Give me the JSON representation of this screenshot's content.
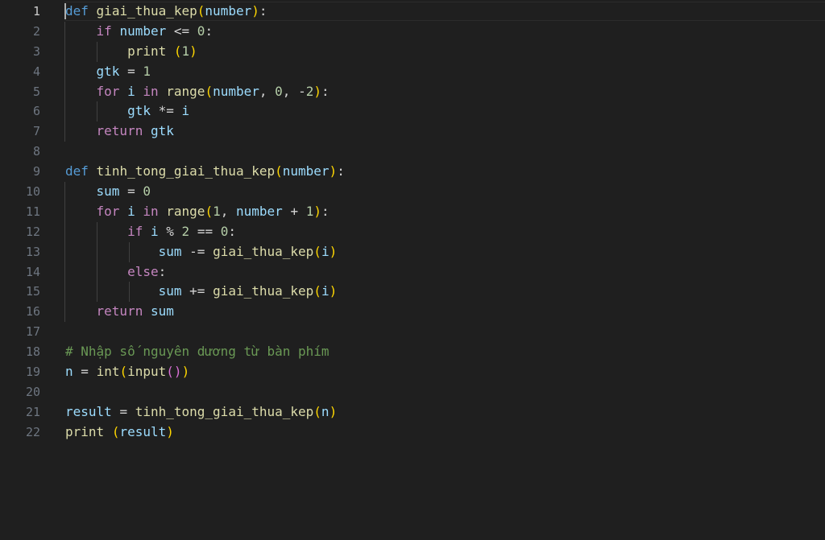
{
  "editor": {
    "active_line": 1,
    "line_numbers": [
      "1",
      "2",
      "3",
      "4",
      "5",
      "6",
      "7",
      "8",
      "9",
      "10",
      "11",
      "12",
      "13",
      "14",
      "15",
      "16",
      "17",
      "18",
      "19",
      "20",
      "21",
      "22"
    ],
    "theme_colors": {
      "background": "#1f1f1f",
      "keyword": "#569cd6",
      "control": "#c586c0",
      "function": "#dcdcaa",
      "variable": "#9cdcfe",
      "number": "#b5cea8",
      "comment": "#6a9955",
      "bracket_level1": "#ffd700",
      "bracket_level2": "#da70d6"
    },
    "lines": [
      "def giai_thua_kep(number):",
      "    if number <= 0:",
      "        print (1)",
      "    gtk = 1",
      "    for i in range(number, 0, -2):",
      "        gtk *= i",
      "    return gtk",
      "",
      "def tinh_tong_giai_thua_kep(number):",
      "    sum = 0",
      "    for i in range(1, number + 1):",
      "        if i % 2 == 0:",
      "            sum -= giai_thua_kep(i)",
      "        else:",
      "            sum += giai_thua_kep(i)",
      "    return sum",
      "",
      "# Nhập số nguyên dương từ bàn phím",
      "n = int(input())",
      "",
      "result = tinh_tong_giai_thua_kep(n)",
      "print (result)"
    ]
  }
}
